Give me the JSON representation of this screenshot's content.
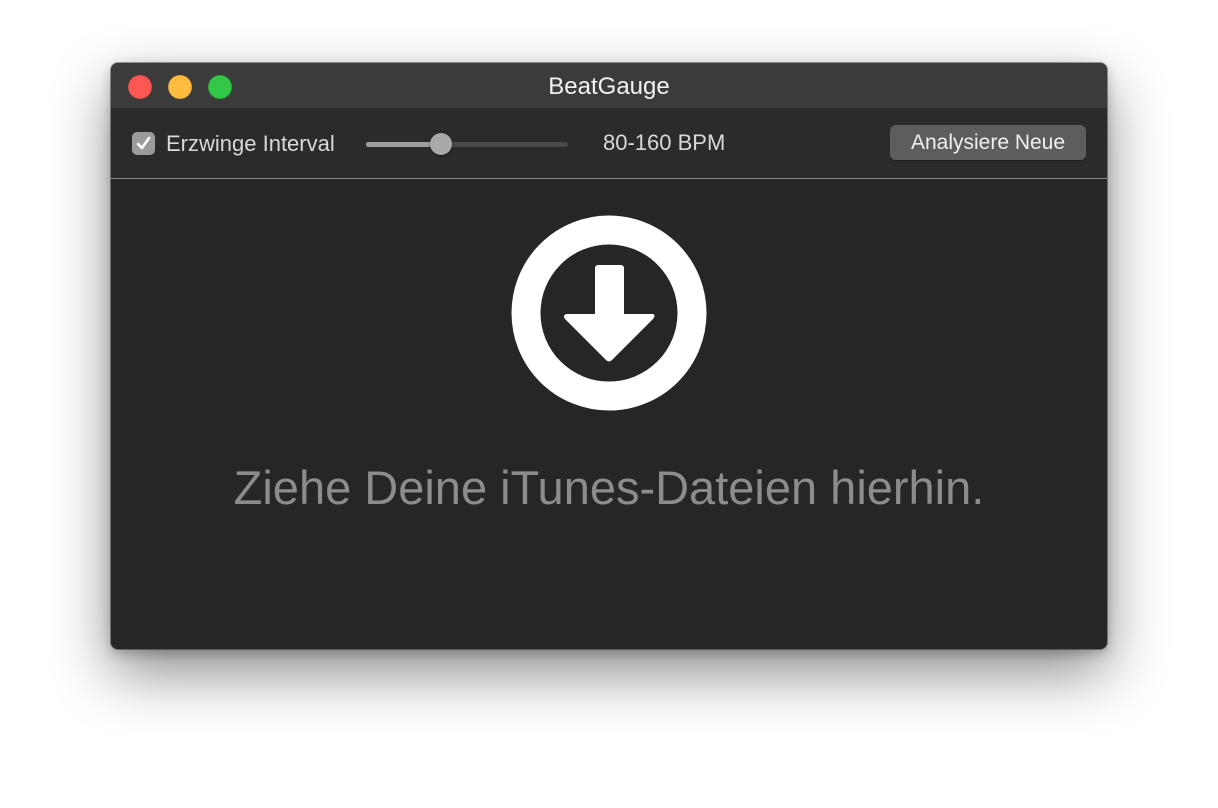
{
  "window": {
    "title": "BeatGauge"
  },
  "traffic_lights": {
    "close_color": "#fc5753",
    "minimize_color": "#fdbc40",
    "zoom_color": "#33c748"
  },
  "toolbar": {
    "force_interval_label": "Erzwinge Interval",
    "force_interval_checked": true,
    "bpm_slider_value": 0.37,
    "bpm_range_label": "80-160 BPM",
    "analyze_button_label": "Analysiere Neue"
  },
  "drop_zone": {
    "icon": "arrow-down-circle-icon",
    "message": "Ziehe Deine iTunes-Dateien hierhin."
  }
}
